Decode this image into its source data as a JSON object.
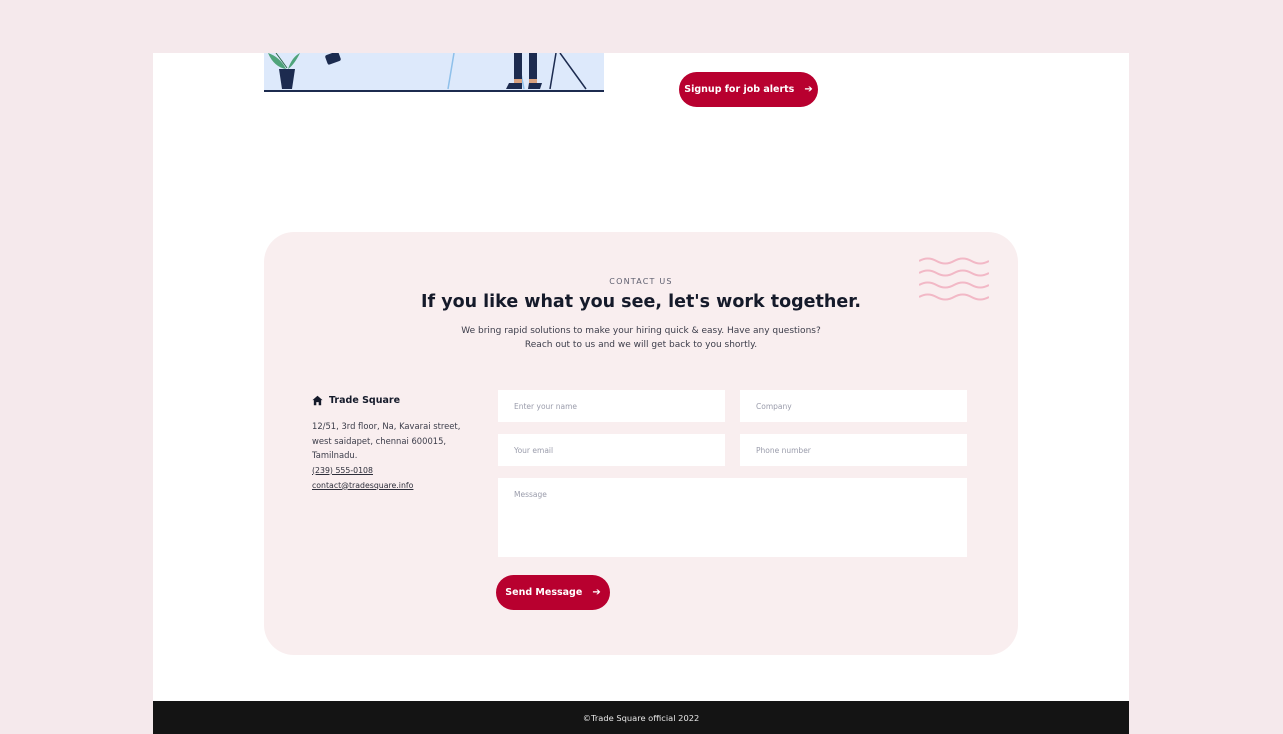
{
  "colors": {
    "page_background": "#f5e9ec",
    "accent": "#b8002f",
    "card_background": "#f9eeef",
    "footer_background": "#141414",
    "waves": "#f2b8c6"
  },
  "hero": {
    "signup_label": "Signup for job alerts",
    "signup_icon": "arrow-right-icon"
  },
  "contact": {
    "eyebrow": "CONTACT US",
    "heading": "If you like what you see, let's work together.",
    "description_line1": "We bring rapid solutions to make your hiring quick & easy. Have any questions?",
    "description_line2": "Reach out to us and we will get back to you shortly.",
    "company": {
      "icon": "home-icon",
      "name": "Trade Square",
      "address_line1": "12/51, 3rd floor, Na, Kavarai street,",
      "address_line2": "west saidapet, chennai 600015,",
      "address_line3": "Tamilnadu.",
      "phone": "(239) 555-0108",
      "email": "contact@tradesquare.info"
    },
    "form": {
      "name_placeholder": "Enter your name",
      "company_placeholder": "Company",
      "email_placeholder": "Your email",
      "phone_placeholder": "Phone number",
      "message_placeholder": "Message",
      "send_label": "Send Message",
      "send_icon": "arrow-right-icon"
    }
  },
  "footer": {
    "copyright": "©Trade Square official 2022"
  }
}
